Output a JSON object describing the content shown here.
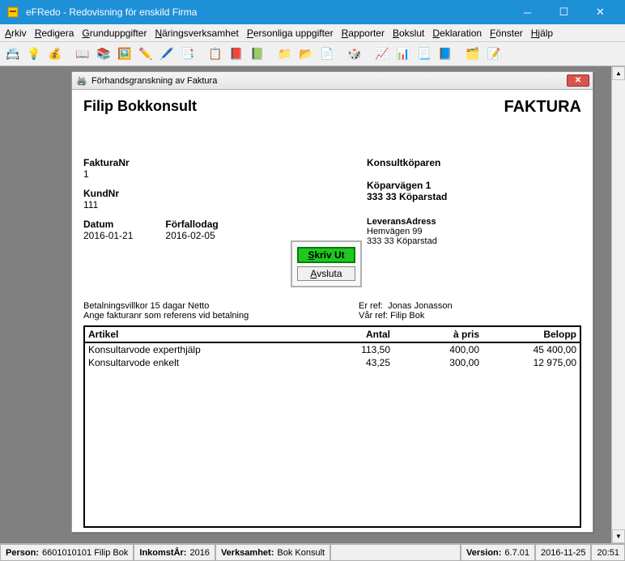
{
  "window": {
    "title": "eFRedo - Redovisning för enskild Firma"
  },
  "menu": {
    "arkiv": "Arkiv",
    "redigera": "Redigera",
    "grunduppgifter": "Grunduppgifter",
    "naringsverksamhet": "Näringsverksamhet",
    "personliga": "Personliga uppgifter",
    "rapporter": "Rapporter",
    "bokslut": "Bokslut",
    "deklaration": "Deklaration",
    "fonster": "Fönster",
    "hjalp": "Hjälp"
  },
  "preview": {
    "title": "Förhandsgranskning av Faktura",
    "company": "Filip Bokkonsult",
    "doc_type": "FAKTURA",
    "fakturanr_label": "FakturaNr",
    "fakturanr": "1",
    "kundnr_label": "KundNr",
    "kundnr": "111",
    "datum_label": "Datum",
    "datum": "2016-01-21",
    "forfall_label": "Förfallodag",
    "forfall": "2016-02-05",
    "buyer_name": "Konsultköparen",
    "buyer_addr1": "Köparvägen 1",
    "buyer_addr2": "333 33 Köparstad",
    "lev_label": "LeveransAdress",
    "lev_addr1": "Hemvägen 99",
    "lev_addr2": "333 33 Köparstad",
    "btn_skriv": "Skriv Ut",
    "btn_avsluta": "Avsluta",
    "pay_terms": "Betalningsvillkor 15 dagar Netto",
    "pay_ref_note": "Ange fakturanr som referens vid betalning",
    "er_ref_label": "Er ref:",
    "er_ref": "Jonas Jonasson",
    "var_ref_label": "Vår ref:",
    "var_ref": "Filip Bok",
    "col_artikel": "Artikel",
    "col_antal": "Antal",
    "col_apris": "à pris",
    "col_belopp": "Belopp",
    "items": [
      {
        "artikel": "Konsultarvode experthjälp",
        "antal": "113,50",
        "apris": "400,00",
        "belopp": "45 400,00"
      },
      {
        "artikel": "Konsultarvode enkelt",
        "antal": "43,25",
        "apris": "300,00",
        "belopp": "12 975,00"
      }
    ]
  },
  "status": {
    "person_label": "Person:",
    "person": "6601010101  Filip Bok",
    "inkomst_label": "InkomstÅr:",
    "inkomst": "2016",
    "verksamhet_label": "Verksamhet:",
    "verksamhet": "Bok Konsult",
    "version_label": "Version:",
    "version": "6.7.01",
    "date": "2016-11-25",
    "time": "20:51"
  }
}
